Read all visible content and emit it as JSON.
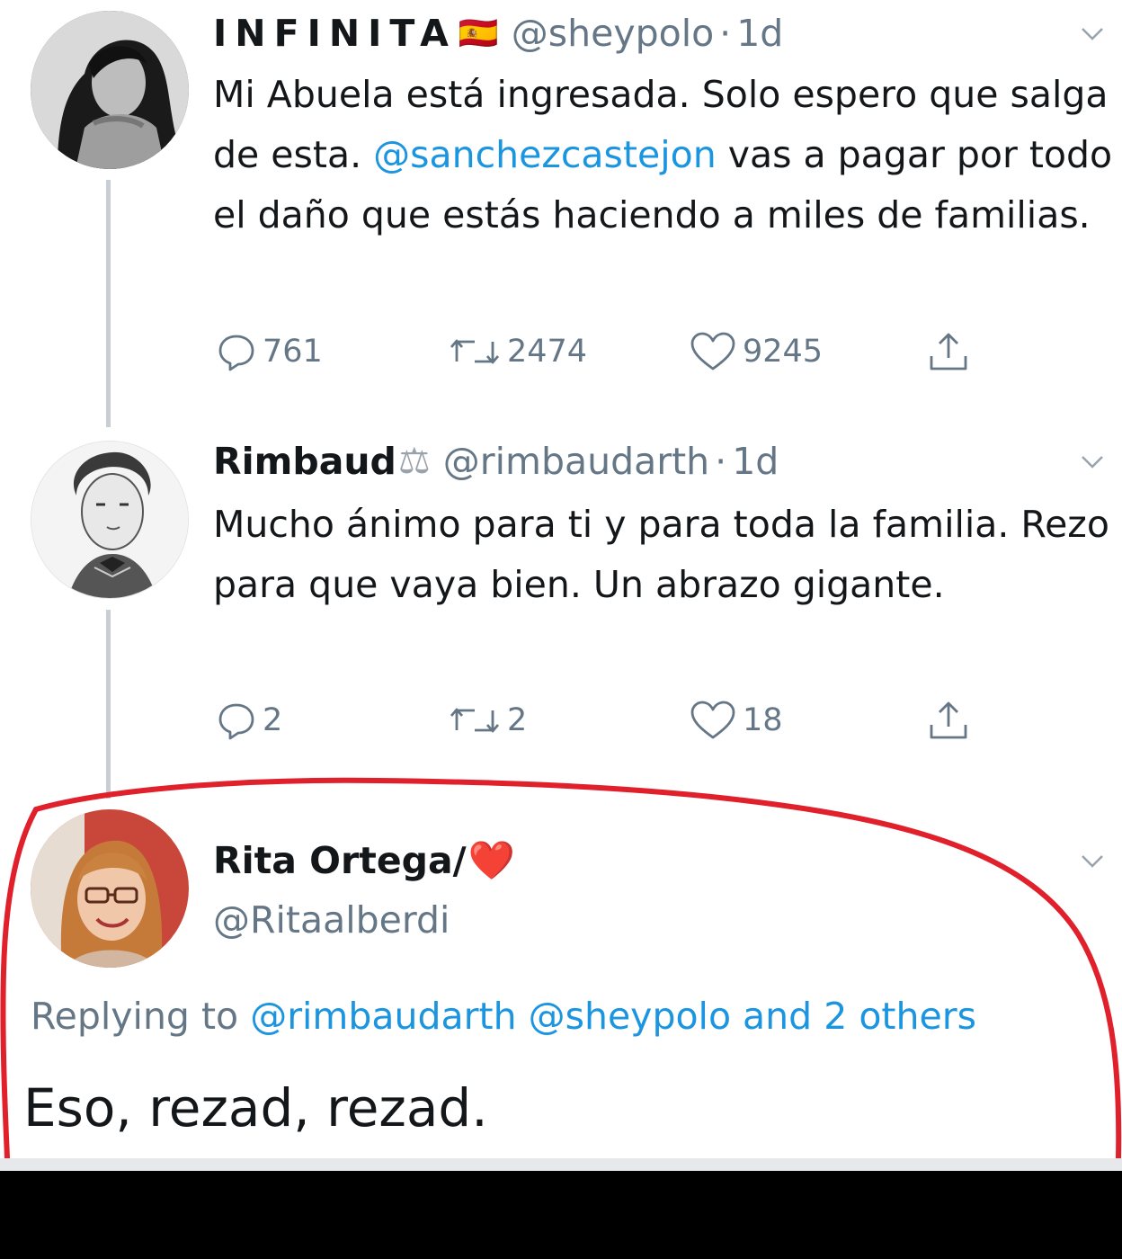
{
  "tweets": [
    {
      "display_name": "INFINITA",
      "flag": "🇪🇸",
      "handle": "@sheypolo",
      "separator": "·",
      "time": "1d",
      "text_before": "Mi Abuela está ingresada. Solo espero que salga de esta. ",
      "mention": "@sanchezcastejon",
      "text_after": " vas a pagar por todo el daño que estás haciendo a miles de familias.",
      "replies": "761",
      "retweets": "2474",
      "likes": "9245"
    },
    {
      "display_name": "Rimbaud",
      "badge": "⚖",
      "handle": "@rimbaudarth",
      "separator": "·",
      "time": "1d",
      "text": "Mucho ánimo para ti y para toda la familia. Rezo para que vaya bien. Un abrazo gigante.",
      "replies": "2",
      "retweets": "2",
      "likes": "18"
    }
  ],
  "highlighted_reply": {
    "display_name": "Rita Ortega/",
    "heart": "❤️",
    "handle": "@Ritaalberdi",
    "replying_prefix": "Replying to ",
    "replying_to": "@rimbaudarth @sheypolo and 2 others",
    "text": "Eso, rezad, rezad.",
    "highlight_color": "#e0202a"
  },
  "colors": {
    "link": "#1b95e0",
    "muted": "#657786",
    "thread_line": "#c9ced3"
  },
  "icons": [
    "reply-icon",
    "retweet-icon",
    "like-icon",
    "share-icon",
    "chevron-down-icon"
  ]
}
